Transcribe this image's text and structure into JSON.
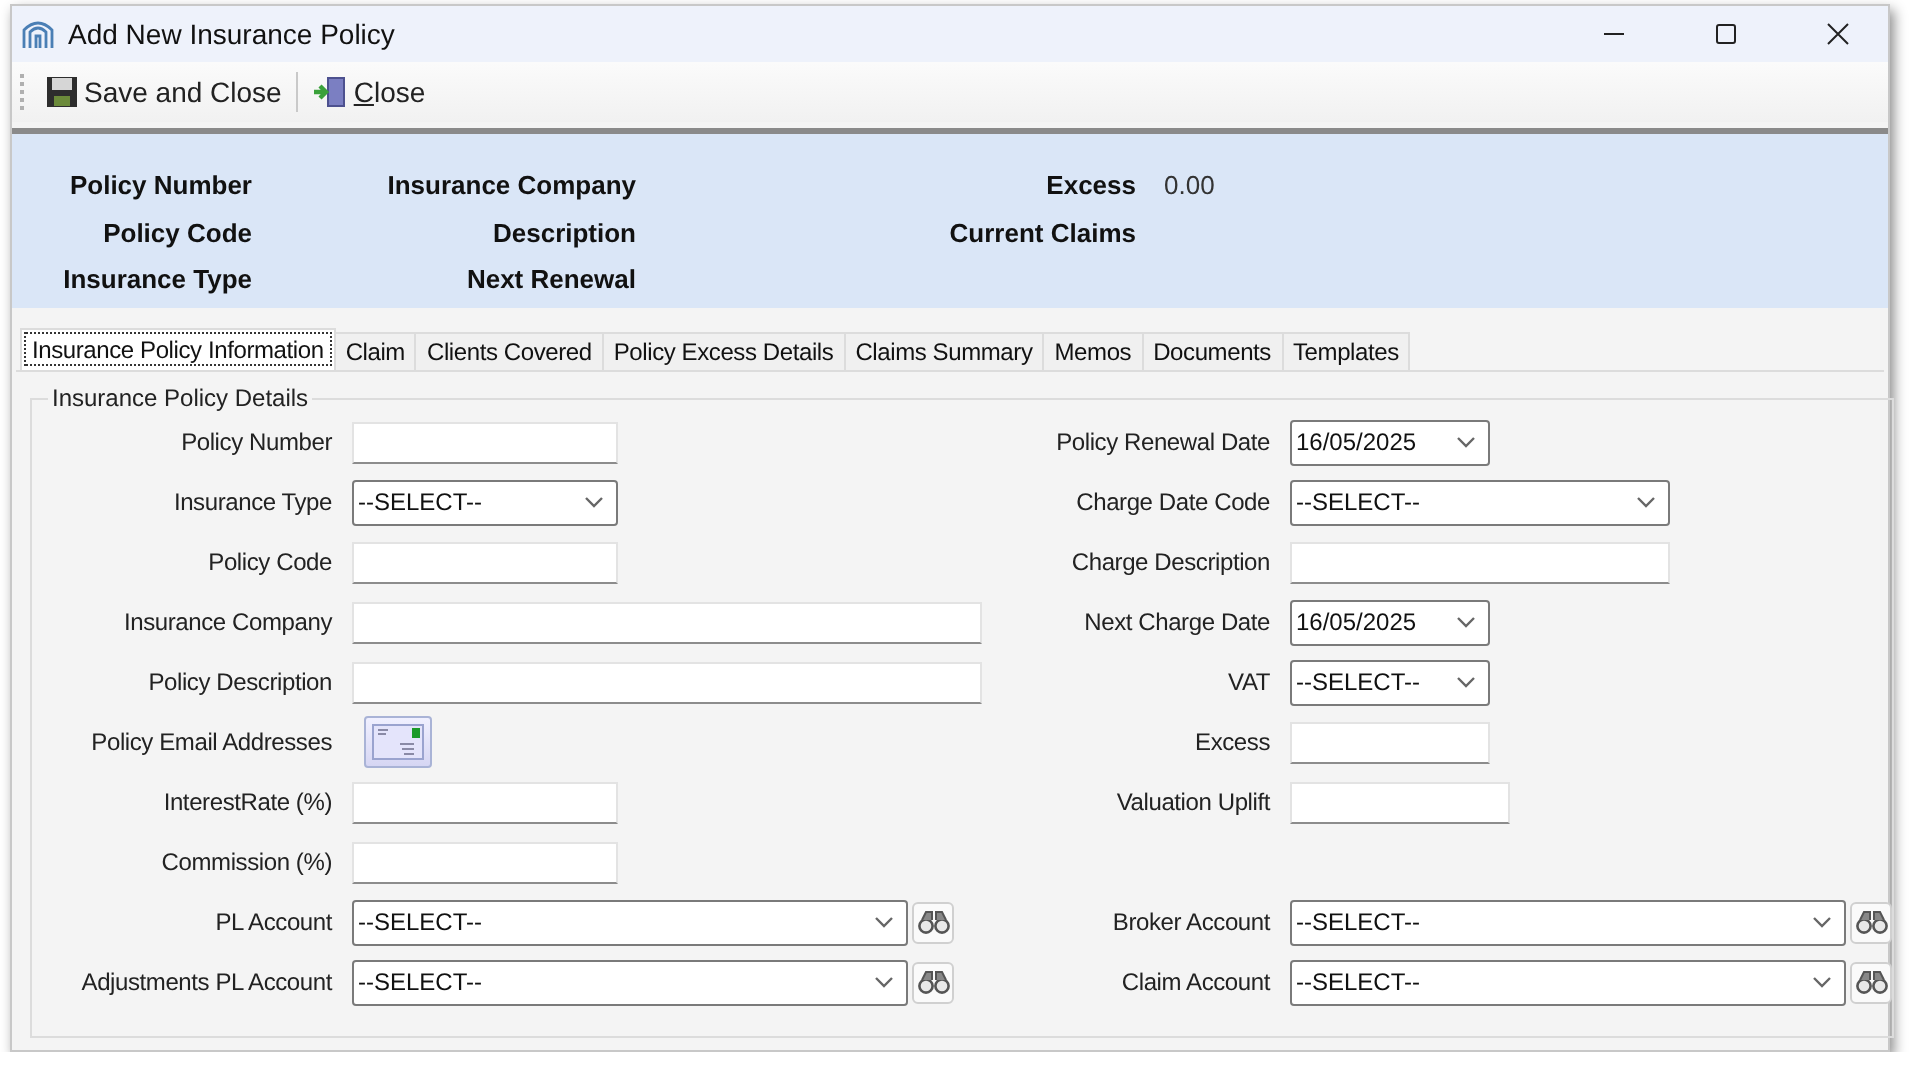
{
  "window": {
    "title": "Add New Insurance Policy"
  },
  "toolbar": [
    {
      "label": "Save and Close",
      "kind": "save"
    },
    {
      "label": "Close",
      "kind": "close"
    }
  ],
  "header": {
    "columns": [
      [
        {
          "label": "Policy Number"
        },
        {
          "label": "Policy Code"
        },
        {
          "label": "Insurance Type"
        }
      ],
      [
        {
          "label": "Insurance Company"
        },
        {
          "label": "Description"
        },
        {
          "label": "Next Renewal"
        }
      ],
      [
        {
          "label": "Excess",
          "value": "0.00"
        },
        {
          "label": "Current Claims"
        }
      ]
    ]
  },
  "tabs": [
    {
      "label": "Insurance Policy Information",
      "selected": true
    },
    {
      "label": "Claim",
      "selected": false
    },
    {
      "label": "Clients Covered",
      "selected": false
    },
    {
      "label": "Policy Excess Details",
      "selected": false
    },
    {
      "label": "Claims Summary",
      "selected": false
    },
    {
      "label": "Memos",
      "selected": false
    },
    {
      "label": "Documents",
      "selected": false
    },
    {
      "label": "Templates",
      "selected": false
    }
  ],
  "group": {
    "title": "Insurance Policy Details",
    "left": [
      {
        "label": "Policy Number",
        "kind": "text"
      },
      {
        "label": "Insurance Type",
        "kind": "select",
        "value": "--SELECT--"
      },
      {
        "label": "Policy Code",
        "kind": "text"
      },
      {
        "label": "Insurance Company",
        "kind": "text"
      },
      {
        "label": "Policy Description",
        "kind": "text"
      },
      {
        "label": "Policy Email Addresses",
        "kind": "email"
      },
      {
        "label": "InterestRate (%)",
        "kind": "text"
      },
      {
        "label": "Commission (%)",
        "kind": "text"
      },
      {
        "label": "PL Account",
        "kind": "lookup",
        "value": "--SELECT--"
      },
      {
        "label": "Adjustments PL Account",
        "kind": "lookup",
        "value": "--SELECT--"
      }
    ],
    "right": [
      {
        "label": "Policy Renewal Date",
        "kind": "date",
        "value": "16/05/2025"
      },
      {
        "label": "Charge Date Code",
        "kind": "select",
        "value": "--SELECT--"
      },
      {
        "label": "Charge Description",
        "kind": "text"
      },
      {
        "label": "Next Charge Date",
        "kind": "date",
        "value": "16/05/2025"
      },
      {
        "label": "VAT",
        "kind": "select",
        "value": "--SELECT--"
      },
      {
        "label": "Excess",
        "kind": "text"
      },
      {
        "label": "Valuation Uplift",
        "kind": "text"
      },
      {
        "label": "Broker Account",
        "kind": "lookup",
        "value": "--SELECT--"
      },
      {
        "label": "Claim Account",
        "kind": "lookup",
        "value": "--SELECT--"
      }
    ]
  }
}
